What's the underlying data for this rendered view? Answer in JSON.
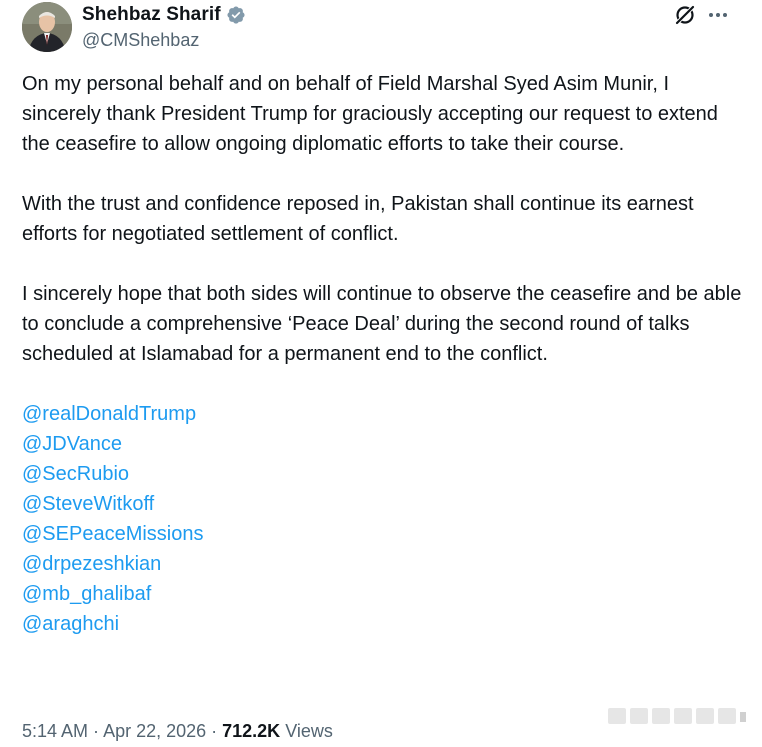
{
  "author": {
    "display_name": "Shehbaz Sharif",
    "handle": "@CMShehbaz",
    "verified": true,
    "verified_color": "#829aab"
  },
  "icons": {
    "grok": "grok-icon",
    "more": "more-horizontal-icon",
    "verified": "verified-badge-icon"
  },
  "tweet": {
    "paragraphs": [
      "On my personal behalf and on behalf of Field Marshal Syed Asim Munir, I sincerely thank President Trump for graciously accepting our request to extend the ceasefire to allow ongoing diplomatic efforts to take their course.",
      "With the trust and confidence reposed in, Pakistan shall continue its earnest efforts for negotiated settlement of conflict.",
      "I sincerely hope that both sides will continue to observe the ceasefire and be able to conclude a comprehensive ‘Peace Deal’ during the second round of talks scheduled at Islamabad for a permanent end to the conflict."
    ],
    "mentions": [
      "@realDonaldTrump",
      "@JDVance",
      "@SecRubio",
      "@SteveWitkoff",
      "@SEPeaceMissions",
      "@drpezeshkian",
      "@mb_ghalibaf",
      "@araghchi"
    ]
  },
  "meta": {
    "time": "5:14 AM",
    "separator": " · ",
    "date": "Apr 22, 2026",
    "views_count": "712.2K",
    "views_label": " Views"
  },
  "colors": {
    "text": "#0f1419",
    "secondary": "#536471",
    "link": "#1d9bf0"
  }
}
